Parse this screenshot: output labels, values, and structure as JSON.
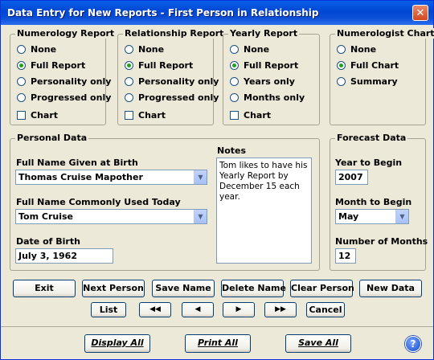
{
  "window": {
    "title": "Data Entry for New Reports - First Person in Relationship",
    "close": "✕"
  },
  "numerology": {
    "title": "Numerology Report",
    "options": [
      "None",
      "Full Report",
      "Personality only",
      "Progressed only"
    ],
    "chart": "Chart",
    "selected": 1
  },
  "relationship": {
    "title": "Relationship Report",
    "options": [
      "None",
      "Full Report",
      "Personality only",
      "Progressed only"
    ],
    "chart": "Chart",
    "selected": 1
  },
  "yearly": {
    "title": "Yearly Report",
    "options": [
      "None",
      "Full Report",
      "Years only",
      "Months only"
    ],
    "chart": "Chart",
    "selected": 1
  },
  "numerologist": {
    "title": "Numerologist Chart",
    "options": [
      "None",
      "Full Chart",
      "Summary"
    ],
    "selected": 1
  },
  "personal": {
    "title": "Personal Data",
    "birth_name_label": "Full Name Given at Birth",
    "birth_name_value": "Thomas Cruise Mapother",
    "common_name_label": "Full Name Commonly Used Today",
    "common_name_value": "Tom Cruise",
    "dob_label": "Date of Birth",
    "dob_value": "July 3, 1962",
    "notes_label": "Notes",
    "notes_value": "Tom likes to have his Yearly Report by December 15 each year."
  },
  "forecast": {
    "title": "Forecast Data",
    "year_label": "Year to Begin",
    "year_value": "2007",
    "month_label": "Month to Begin",
    "month_value": "May",
    "months_label": "Number of Months",
    "months_value": "12"
  },
  "buttons": {
    "exit": "Exit",
    "next_person": "Next Person",
    "save_name": "Save Name",
    "delete_name": "Delete Name",
    "clear_person": "Clear Person",
    "new_data": "New Data",
    "list": "List",
    "first": "◀◀",
    "prev": "◀",
    "next": "▶",
    "last": "▶▶",
    "cancel": "Cancel",
    "display_all": "Display All",
    "print_all": "Print All",
    "save_all": "Save All"
  },
  "help": "?",
  "icons": {
    "close": "close-icon",
    "help": "help-icon",
    "dropdown": "chevron-down-icon"
  },
  "colors": {
    "titlebar": "#0047d3",
    "face": "#ece9d8",
    "radio_dot": "#21a121"
  }
}
